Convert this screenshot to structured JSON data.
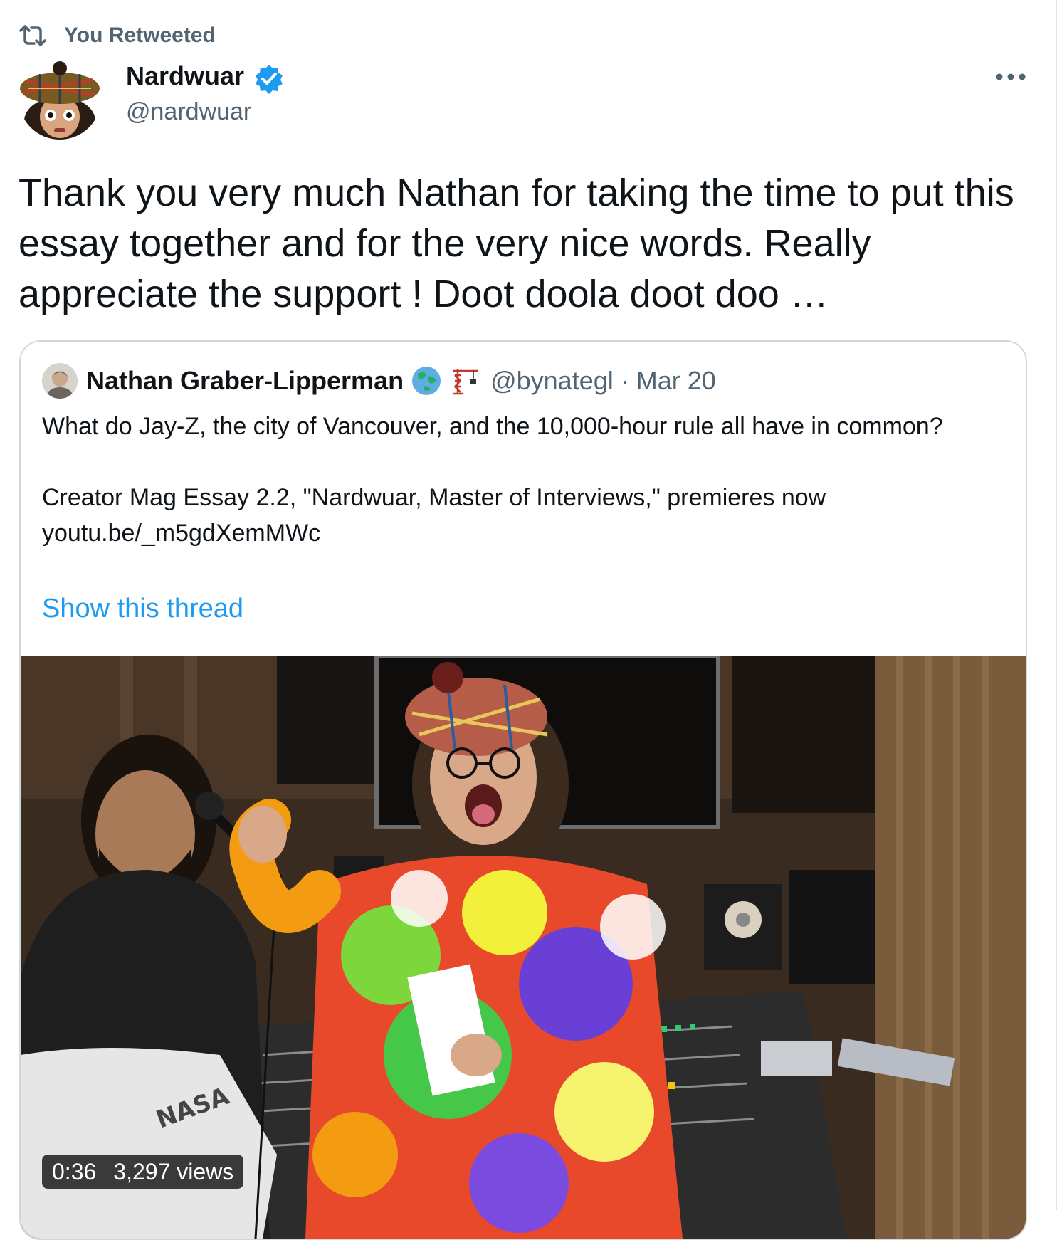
{
  "social_context": {
    "label": "You Retweeted",
    "icon": "retweet-icon"
  },
  "author": {
    "name": "Nardwuar",
    "handle": "@nardwuar",
    "verified": true,
    "verified_color": "#1d9bf0"
  },
  "tweet": {
    "text": "Thank you very much Nathan for taking the time to put this essay together and for the very nice words. Really appreciate the support ! Doot doola doot doo …"
  },
  "quoted": {
    "name": "Nathan Graber-Lipperman",
    "emojis": [
      "globe-asia-emoji",
      "construction-crane-emoji"
    ],
    "handle": "@bynategl",
    "separator": "·",
    "date": "Mar 20",
    "line1": "What do Jay-Z, the city of Vancouver, and the 10,000-hour rule all have in common?",
    "line2": "Creator Mag Essay 2.2, \"Nardwuar, Master of Interviews,\" premieres now",
    "link": "youtu.be/_m5gdXemMWc",
    "show_thread": "Show this thread",
    "media": {
      "duration": "0:36",
      "views": "3,297 views",
      "shirt_print": "NASA"
    }
  },
  "colors": {
    "text": "#0f1419",
    "secondary": "#536471",
    "link": "#1d9bf0",
    "border": "#cfd9de"
  }
}
